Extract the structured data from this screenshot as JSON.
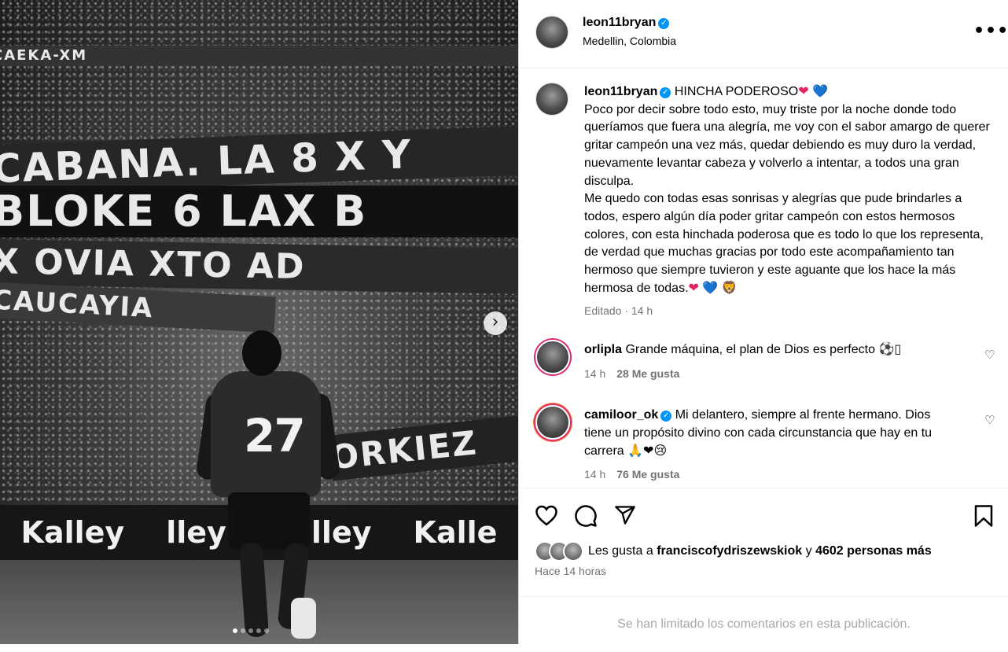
{
  "media": {
    "banners": [
      "CABANA.  LA 8 X Y",
      "BLOKE 6 LAX B",
      "X  OVIA  XTO  AD",
      "CAUCAYIA",
      "ORKIEZ",
      "CAEKA-XM"
    ],
    "ad_texts": [
      "Kalley",
      "lley",
      "Kalley",
      "Kalle"
    ],
    "jersey_number": "27",
    "next_glyph": "›",
    "carousel_dots": 5,
    "active_dot": 0
  },
  "header": {
    "username": "leon11bryan",
    "verified_glyph": "✓",
    "location": "Medellin, Colombia",
    "more_glyph": "•••"
  },
  "caption": {
    "username": "leon11bryan",
    "title": "HINCHA PODEROSO",
    "title_emojis": [
      "❤",
      "💙"
    ],
    "paragraph1": "Poco por decir sobre todo esto, muy triste por la noche donde todo queríamos que fuera una alegría, me voy con el sabor amargo de querer gritar campeón una vez más, quedar debiendo es muy duro la verdad, nuevamente levantar cabeza y volverlo a intentar, a todos una gran disculpa.",
    "paragraph2": "Me quedo con todas esas sonrisas y alegrías que pude brindarles a todos, espero algún día poder gritar campeón con estos hermosos colores, con esta hinchada poderosa que es todo lo que los representa, de verdad que muchas gracias por todo este acompañamiento tan hermoso que siempre tuvieron y este aguante que los hace la más hermosa de todas.",
    "end_emojis": [
      "❤",
      "💙",
      "🦁"
    ],
    "meta": "Editado · 14 h"
  },
  "comments": [
    {
      "username": "orlipla",
      "text": "Grande máquina, el plan de Dios es perfecto ⚽▯",
      "time": "14 h",
      "likes": "28 Me gusta"
    },
    {
      "username": "camiloor_ok",
      "text": "Mi delantero, siempre al frente hermano. Dios tiene un propósito divino con cada circunstancia que hay en tu carrera 🙏❤😢",
      "time": "14 h",
      "likes": "76 Me gusta"
    }
  ],
  "likes": {
    "prefix": "Les gusta a",
    "user": "franciscofydriszewskiok",
    "middle": "y",
    "others": "4602 personas más"
  },
  "time_ago": "Hace 14 horas",
  "footer": "Se han limitado los comentarios en esta publicación.",
  "icon_names": [
    "heart-icon",
    "comment-icon",
    "share-icon",
    "bookmark-icon"
  ],
  "colors": {
    "verified": "#0095f6",
    "meta_gray": "#737373",
    "footer_gray": "#a8a8a8"
  }
}
